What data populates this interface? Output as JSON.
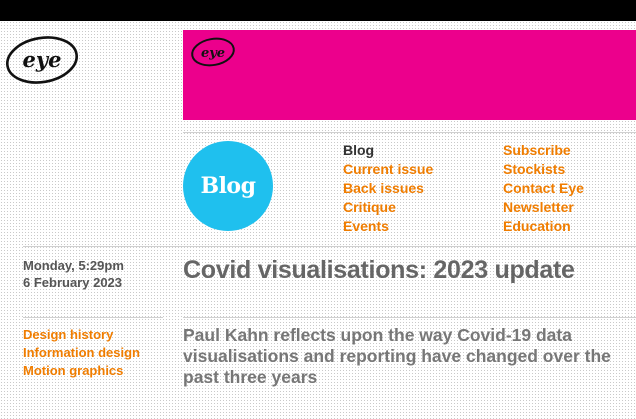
{
  "header": {
    "logo_text": "eye",
    "banner_logo_text": "eye",
    "banner_color": "#ec008c"
  },
  "section": {
    "badge": "Blog",
    "badge_color": "#1fc0ee"
  },
  "nav": {
    "col1": [
      "Blog",
      "Current issue",
      "Back issues",
      "Critique",
      "Events"
    ],
    "col2": [
      "Subscribe",
      "Stockists",
      "Contact Eye",
      "Newsletter",
      "Education"
    ],
    "current": "Blog",
    "link_color": "#f07d00"
  },
  "article": {
    "date_line1": "Monday, 5:29pm",
    "date_line2": "6 February 2023",
    "title": "Covid visualisations: 2023 update",
    "standfirst": "Paul Kahn reflects upon the way Covid-19 data visualisations and reporting have changed over the past three years",
    "tags": [
      "Design history",
      "Information design",
      "Motion graphics"
    ]
  }
}
